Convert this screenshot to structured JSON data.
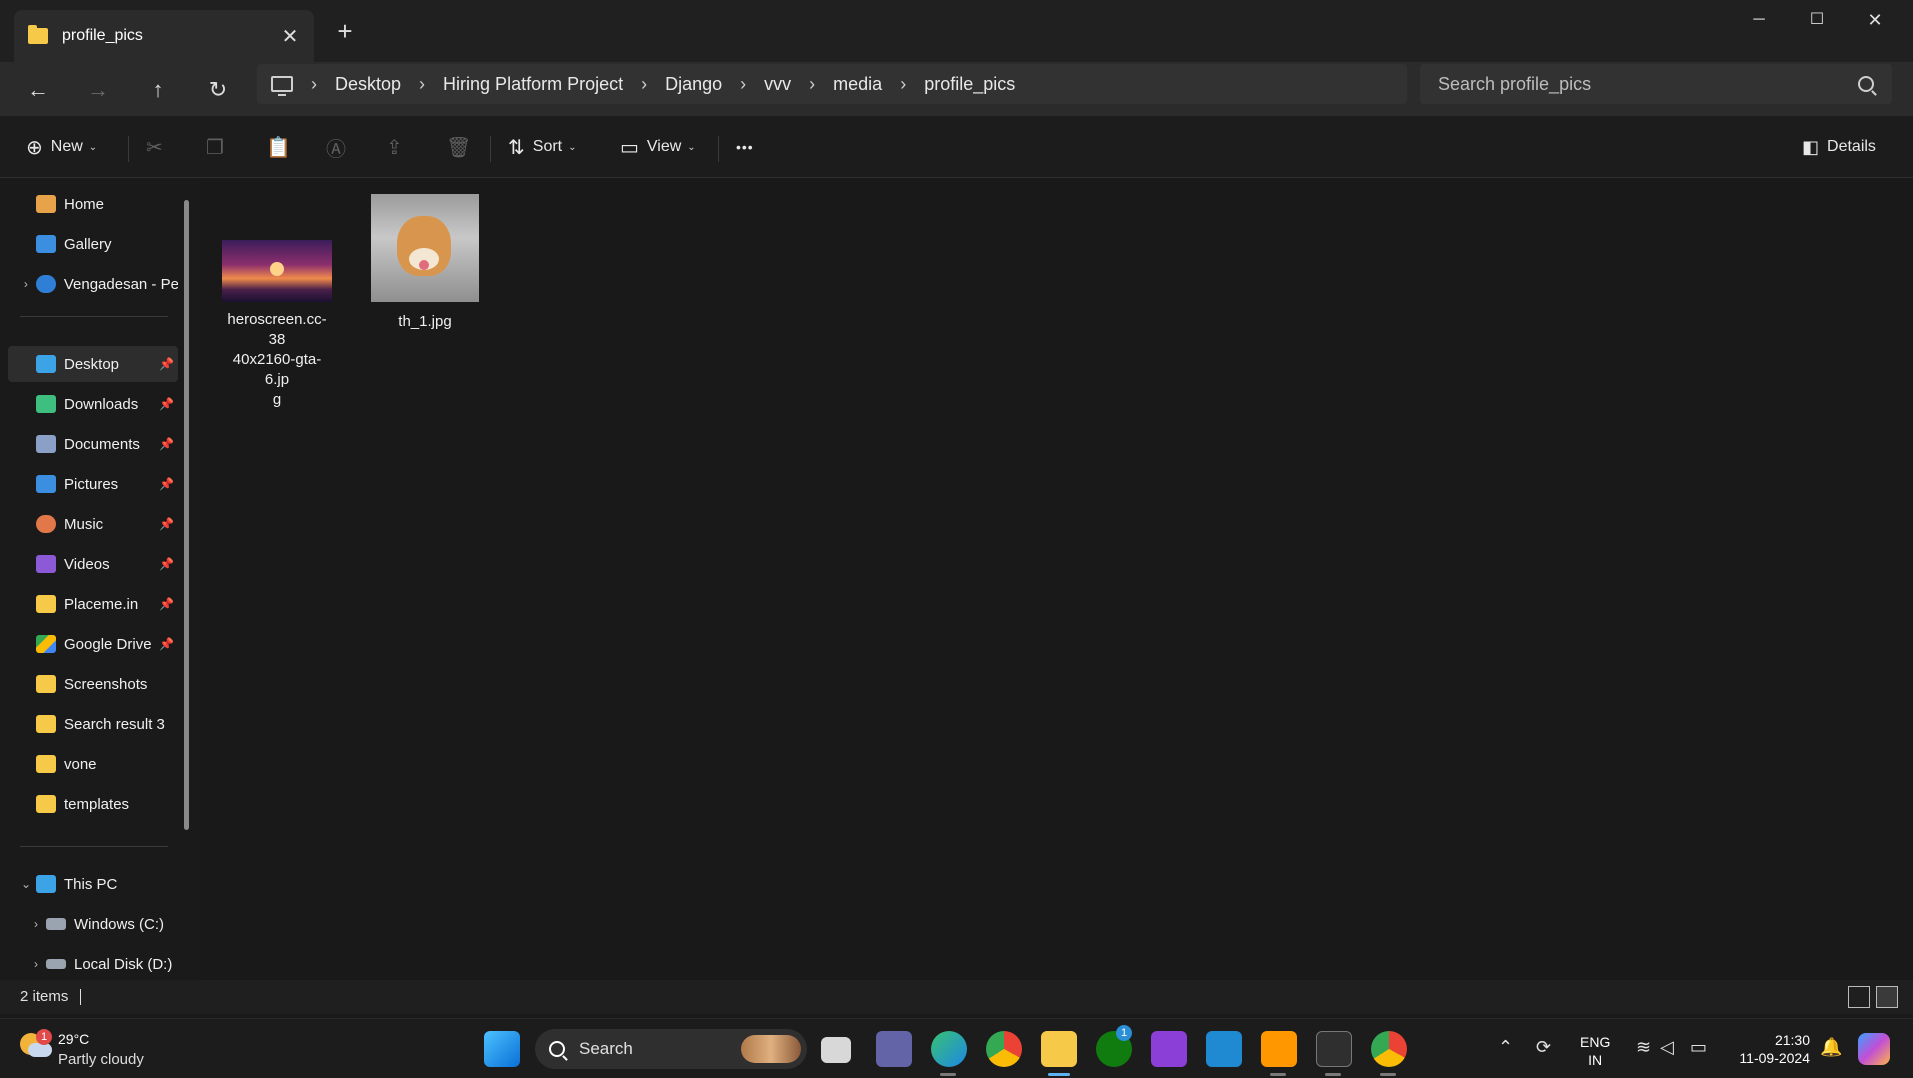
{
  "window": {
    "tab_title": "profile_pics",
    "tab_close": "✕",
    "new_tab": "+",
    "minimize": "─",
    "maximize": "☐",
    "close": "✕"
  },
  "nav": {
    "back": "←",
    "forward": "→",
    "up": "↑",
    "refresh": "↻",
    "breadcrumb": [
      "Desktop",
      "Hiring Platform Project",
      "Django",
      "vvv",
      "media",
      "profile_pics"
    ],
    "breadcrumb_separator": "›",
    "search_placeholder": "Search profile_pics"
  },
  "commands": {
    "new_label": "New",
    "sort_label": "Sort",
    "view_label": "View",
    "more_label": "•••",
    "details_label": "Details",
    "caret": "⌄"
  },
  "sidebar": {
    "quick": [
      {
        "label": "Home",
        "icon": "home-icon",
        "color": "#e8a34a"
      },
      {
        "label": "Gallery",
        "icon": "gallery-icon",
        "color": "#3b8ee0"
      },
      {
        "label": "Vengadesan - Pe",
        "icon": "onedrive-icon",
        "color": "#2f7fd6"
      }
    ],
    "pinned": [
      {
        "label": "Desktop",
        "icon": "desktop-icon",
        "color": "#3ba3e6",
        "pinned": true
      },
      {
        "label": "Downloads",
        "icon": "downloads-icon",
        "color": "#3fbf7f",
        "pinned": true
      },
      {
        "label": "Documents",
        "icon": "documents-icon",
        "color": "#8aa0c6",
        "pinned": true
      },
      {
        "label": "Pictures",
        "icon": "pictures-icon",
        "color": "#3b8ee0",
        "pinned": true
      },
      {
        "label": "Music",
        "icon": "music-icon",
        "color": "#e0784a",
        "pinned": true
      },
      {
        "label": "Videos",
        "icon": "videos-icon",
        "color": "#8c5ad6",
        "pinned": true
      },
      {
        "label": "Placeme.in",
        "icon": "folder-icon",
        "color": "#f7c948",
        "pinned": true
      },
      {
        "label": "Google Drive",
        "icon": "google-drive-icon",
        "color": "#34a853",
        "pinned": true
      },
      {
        "label": "Screenshots",
        "icon": "folder-icon",
        "color": "#f7c948",
        "pinned": false
      },
      {
        "label": "Search result 3",
        "icon": "folder-icon",
        "color": "#f7c948",
        "pinned": false
      },
      {
        "label": "vone",
        "icon": "folder-icon",
        "color": "#f7c948",
        "pinned": false
      },
      {
        "label": "templates",
        "icon": "folder-icon",
        "color": "#f7c948",
        "pinned": false
      }
    ],
    "this_pc": "This PC",
    "drives": [
      "Windows (C:)",
      "Local Disk (D:)"
    ],
    "pin_glyph": "📌",
    "chevron_right": "›",
    "chevron_down": "⌄"
  },
  "files": [
    {
      "name_lines": [
        "heroscreen.cc-38",
        "40x2160-gta-6.jp",
        "g"
      ],
      "thumb": "gta-thumbnail"
    },
    {
      "name_lines": [
        "th_1.jpg"
      ],
      "thumb": "dog-thumbnail"
    }
  ],
  "status": {
    "items": "2 items"
  },
  "taskbar": {
    "temperature": "29°C",
    "condition": "Partly cloudy",
    "weather_badge": "1",
    "search_label": "Search",
    "xbox_badge": "1",
    "language_top": "ENG",
    "language_bottom": "IN",
    "time": "21:30",
    "date": "11-09-2024"
  },
  "colors": {
    "accent": "#5fb2f2",
    "folder": "#f7c948"
  }
}
